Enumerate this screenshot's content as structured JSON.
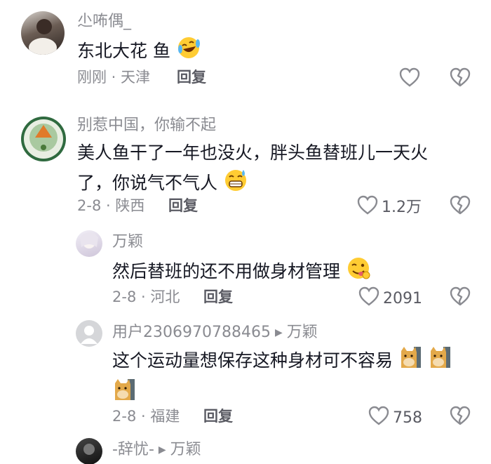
{
  "comments": [
    {
      "name": "尐咘偶_",
      "text": "东北大花  鱼",
      "time": "刚刚",
      "location": "天津",
      "reply": "回复",
      "likes": ""
    },
    {
      "name": "别惹中国，你输不起",
      "text1": "美人鱼干了一年也没火，胖头鱼替班儿一天火",
      "text2": "了，你说气不气人",
      "time": "2-8",
      "location": "陕西",
      "reply": "回复",
      "likes": "1.2万"
    },
    {
      "name": "万颖",
      "text": "然后替班的还不用做身材管理",
      "time": "2-8",
      "location": "河北",
      "reply": "回复",
      "likes": "2091"
    },
    {
      "name": "用户2306970788465",
      "reply_to": "万颖",
      "text": "这个运动量想保存这种身材可不容易",
      "time": "2-8",
      "location": "福建",
      "reply": "回复",
      "likes": "758"
    },
    {
      "name": "-辞忧-",
      "reply_to": "万颖"
    }
  ],
  "icons": {
    "like": "heart-outline-icon",
    "dislike": "broken-heart-icon",
    "reply_arrow": "triangle-right-icon"
  },
  "colors": {
    "text": "#161823",
    "secondary": "#8a8b91",
    "action": "#5a5b63"
  }
}
